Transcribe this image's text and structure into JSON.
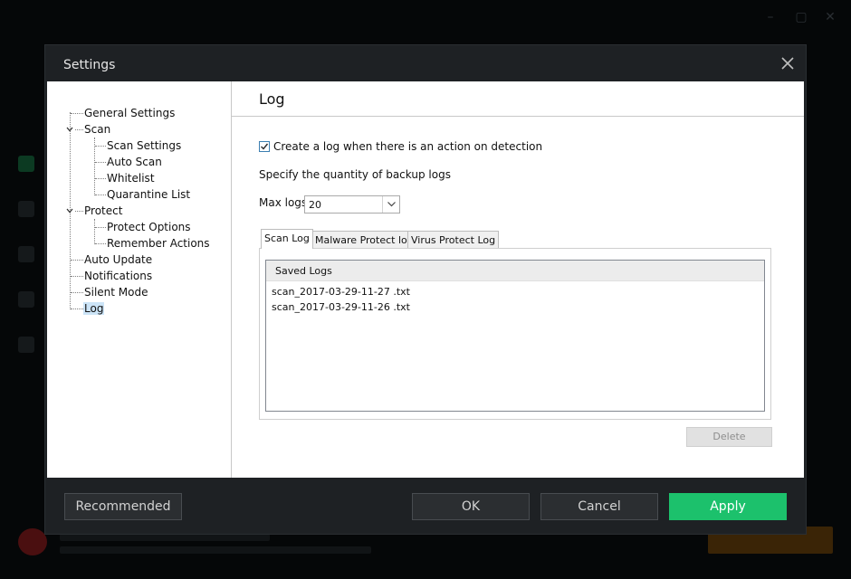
{
  "colors": {
    "dialog_bg": "#1e2124",
    "apply_green": "#1cc16c",
    "selection_blue": "#cce4f7",
    "checkbox_blue": "#3c7fb1"
  },
  "dialog": {
    "title": "Settings",
    "close_icon": "close-icon"
  },
  "tree": {
    "items": [
      {
        "label": "General Settings"
      },
      {
        "label": "Scan",
        "expanded": true
      },
      {
        "label": "Scan Settings"
      },
      {
        "label": "Auto Scan"
      },
      {
        "label": "Whitelist"
      },
      {
        "label": "Quarantine List"
      },
      {
        "label": "Protect",
        "expanded": true
      },
      {
        "label": "Protect Options"
      },
      {
        "label": "Remember Actions"
      },
      {
        "label": "Auto Update"
      },
      {
        "label": "Notifications"
      },
      {
        "label": "Silent Mode"
      },
      {
        "label": "Log",
        "selected": true
      }
    ]
  },
  "log": {
    "title": "Log",
    "create_log_label": "Create a log when there is an action on detection",
    "create_log_checked": true,
    "backup_label": "Specify the quantity of backup logs",
    "max_logs_label": "Max logs",
    "max_logs_value": "20",
    "tabs": [
      {
        "label": "Scan Log",
        "active": true
      },
      {
        "label": "Malware Protect log"
      },
      {
        "label": "Virus Protect Log"
      }
    ],
    "saved_logs_header": "Saved Logs",
    "files": [
      "scan_2017-03-29-11-27 .txt",
      "scan_2017-03-29-11-26 .txt"
    ],
    "delete_label": "Delete"
  },
  "footer": {
    "recommended_label": "Recommended",
    "ok_label": "OK",
    "cancel_label": "Cancel",
    "apply_label": "Apply"
  }
}
